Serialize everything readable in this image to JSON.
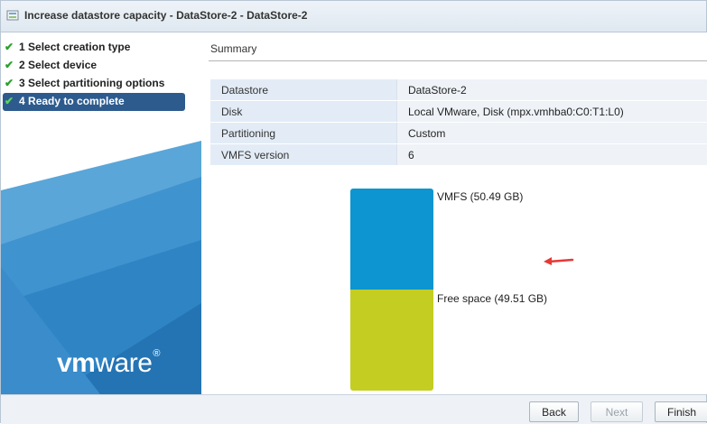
{
  "window": {
    "title": "Increase datastore capacity - DataStore-2 - DataStore-2"
  },
  "sidebar": {
    "steps": [
      {
        "number": "1",
        "label": "Select creation type",
        "status": "done"
      },
      {
        "number": "2",
        "label": "Select device",
        "status": "done"
      },
      {
        "number": "3",
        "label": "Select partitioning options",
        "status": "done"
      },
      {
        "number": "4",
        "label": "Ready to complete",
        "status": "active"
      }
    ],
    "logo": {
      "vm": "vm",
      "ware": "ware",
      "reg": "®"
    }
  },
  "main": {
    "heading": "Summary",
    "rows": [
      {
        "key": "Datastore",
        "value": "DataStore-2"
      },
      {
        "key": "Disk",
        "value": "Local VMware, Disk (mpx.vmhba0:C0:T1:L0)"
      },
      {
        "key": "Partitioning",
        "value": "Custom"
      },
      {
        "key": "VMFS version",
        "value": "6"
      }
    ],
    "partitions": [
      {
        "label": "VMFS  (50.49 GB)",
        "size_gb": 50.49,
        "color": "#0c95d1"
      },
      {
        "label": "Free space  (49.51 GB)",
        "size_gb": 49.51,
        "color": "#c4cd22"
      }
    ]
  },
  "footer": {
    "back": "Back",
    "next": "Next",
    "finish": "Finish"
  },
  "colors": {
    "active_step": "#2d5b8e",
    "check": "#2aa02a",
    "annotation_arrow": "#e53935"
  }
}
